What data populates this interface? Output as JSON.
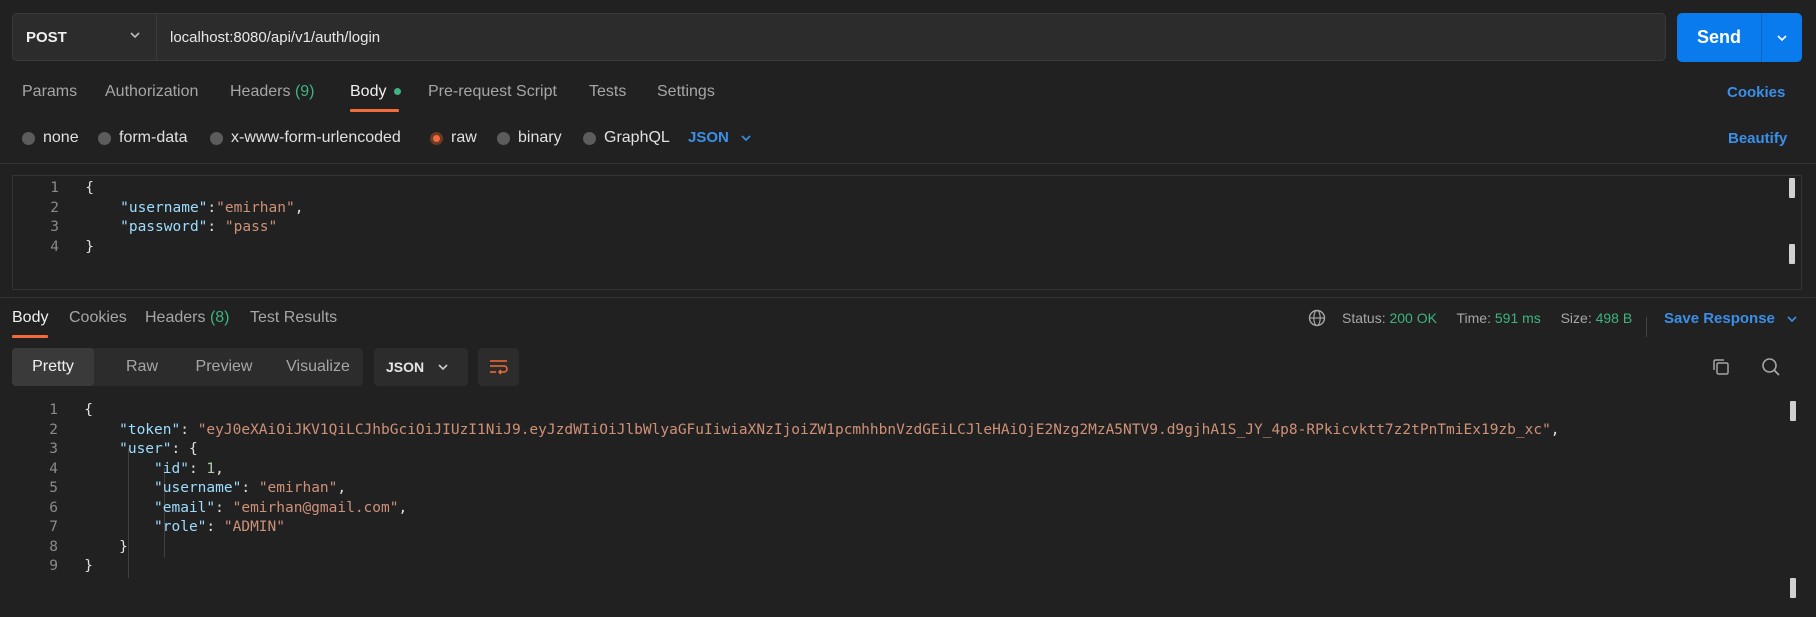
{
  "request": {
    "method": "POST",
    "url": "localhost:8080/api/v1/auth/login",
    "send_label": "Send"
  },
  "request_tabs": [
    {
      "label": "Params"
    },
    {
      "label": "Authorization"
    },
    {
      "label": "Headers",
      "count": "(9)"
    },
    {
      "label": "Body",
      "active": true
    },
    {
      "label": "Pre-request Script"
    },
    {
      "label": "Tests"
    },
    {
      "label": "Settings"
    }
  ],
  "cookies_link": "Cookies",
  "body_types": [
    "none",
    "form-data",
    "x-www-form-urlencoded",
    "raw",
    "binary",
    "GraphQL"
  ],
  "body_selected": "raw",
  "body_format": "JSON",
  "beautify_link": "Beautify",
  "request_body_lines": [
    {
      "n": "1",
      "tokens": [
        [
          "pun",
          "{"
        ]
      ]
    },
    {
      "n": "2",
      "tokens": [
        [
          "key",
          "\"username\""
        ],
        [
          "pun",
          ":"
        ],
        [
          "str",
          "\"emirhan\""
        ],
        [
          "pun",
          ","
        ]
      ]
    },
    {
      "n": "3",
      "tokens": [
        [
          "key",
          "\"password\""
        ],
        [
          "pun",
          ": "
        ],
        [
          "str",
          "\"pass\""
        ]
      ]
    },
    {
      "n": "4",
      "tokens": [
        [
          "pun",
          "}"
        ]
      ]
    }
  ],
  "response_tabs": [
    {
      "label": "Body",
      "active": true
    },
    {
      "label": "Cookies"
    },
    {
      "label": "Headers",
      "count": "(8)"
    },
    {
      "label": "Test Results"
    }
  ],
  "status": {
    "status_label": "Status:",
    "status_value": "200 OK",
    "time_label": "Time:",
    "time_value": "591 ms",
    "size_label": "Size:",
    "size_value": "498 B"
  },
  "save_response": "Save Response",
  "view_modes": [
    "Pretty",
    "Raw",
    "Preview",
    "Visualize"
  ],
  "view_selected": "Pretty",
  "response_format": "JSON",
  "response_body_lines": [
    {
      "n": "1",
      "indent": 0,
      "tokens": [
        [
          "pun",
          "{"
        ]
      ]
    },
    {
      "n": "2",
      "indent": 1,
      "tokens": [
        [
          "key",
          "\"token\""
        ],
        [
          "pun",
          ": "
        ],
        [
          "str",
          "\"eyJ0eXAiOiJKV1QiLCJhbGciOiJIUzI1NiJ9.eyJzdWIiOiJlbWlyaGFuIiwiaXNzIjoiZW1pcmhhbnVzdGEiLCJleHAiOjE2Nzg2MzA5NTV9.d9gjhA1S_JY_4p8-RPkicvktt7z2tPnTmiEx19zb_xc\""
        ],
        [
          "pun",
          ","
        ]
      ]
    },
    {
      "n": "3",
      "indent": 1,
      "tokens": [
        [
          "key",
          "\"user\""
        ],
        [
          "pun",
          ": {"
        ]
      ]
    },
    {
      "n": "4",
      "indent": 2,
      "tokens": [
        [
          "key",
          "\"id\""
        ],
        [
          "pun",
          ": "
        ],
        [
          "num",
          "1"
        ],
        [
          "pun",
          ","
        ]
      ]
    },
    {
      "n": "5",
      "indent": 2,
      "tokens": [
        [
          "key",
          "\"username\""
        ],
        [
          "pun",
          ": "
        ],
        [
          "str",
          "\"emirhan\""
        ],
        [
          "pun",
          ","
        ]
      ]
    },
    {
      "n": "6",
      "indent": 2,
      "tokens": [
        [
          "key",
          "\"email\""
        ],
        [
          "pun",
          ": "
        ],
        [
          "str",
          "\"emirhan@gmail.com\""
        ],
        [
          "pun",
          ","
        ]
      ]
    },
    {
      "n": "7",
      "indent": 2,
      "tokens": [
        [
          "key",
          "\"role\""
        ],
        [
          "pun",
          ": "
        ],
        [
          "str",
          "\"ADMIN\""
        ]
      ]
    },
    {
      "n": "8",
      "indent": 1,
      "tokens": [
        [
          "pun",
          "}"
        ]
      ]
    },
    {
      "n": "9",
      "indent": 0,
      "tokens": [
        [
          "pun",
          "}"
        ]
      ]
    }
  ]
}
